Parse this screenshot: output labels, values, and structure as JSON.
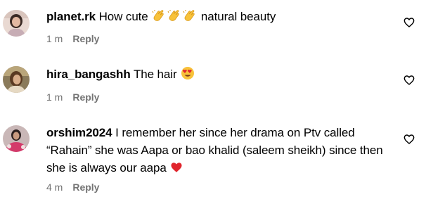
{
  "comments": [
    {
      "username": "planet.rk",
      "text_before": " How cute ",
      "emojis": [
        "clapping-hands",
        "clapping-hands",
        "clapping-hands"
      ],
      "text_after": " natural beauty",
      "time": "1 m",
      "reply_label": "Reply",
      "avatar_icon": "avatar-planet-rk"
    },
    {
      "username": "hira_bangashh",
      "text_before": " The hair ",
      "emojis": [
        "heart-eyes"
      ],
      "text_after": "",
      "time": "1 m",
      "reply_label": "Reply",
      "avatar_icon": "avatar-hira-bangashh"
    },
    {
      "username": "orshim2024",
      "text_before": " I remember her since her drama on Ptv called “Rahain” she was Aapa or bao khalid (saleem sheikh) since then she is always our aapa ",
      "emojis": [
        "red-heart"
      ],
      "text_after": "",
      "time": "4 m",
      "reply_label": "Reply",
      "avatar_icon": "avatar-orshim2024"
    }
  ],
  "like_icon": "heart-outline-icon",
  "colors": {
    "text": "#000000",
    "meta": "#737373",
    "emoji_yellow": "#f8c23a",
    "emoji_red": "#e0252d"
  }
}
